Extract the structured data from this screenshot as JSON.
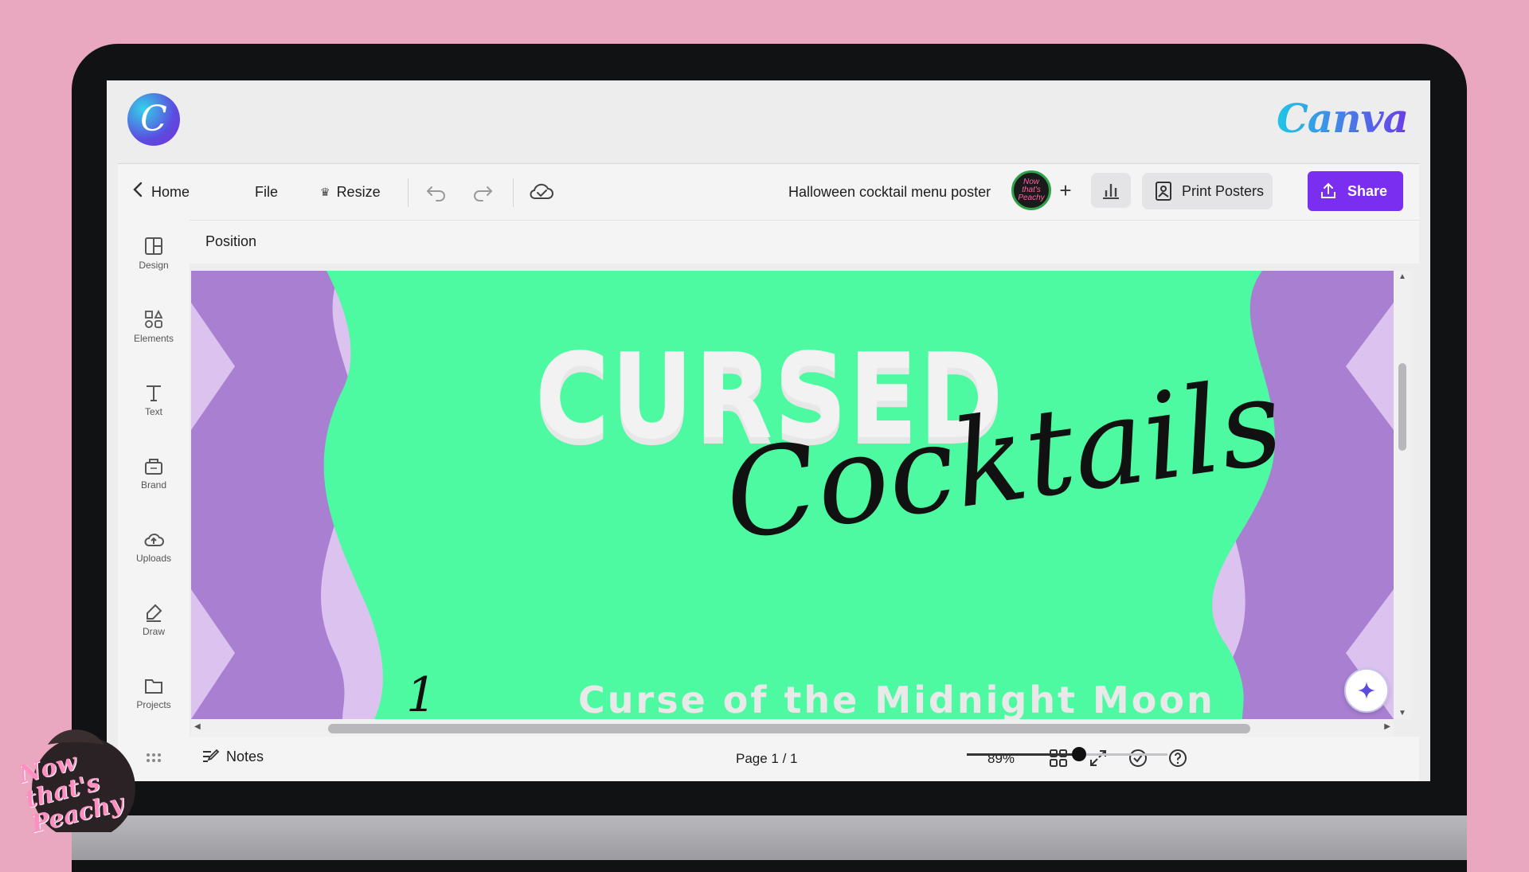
{
  "app": {
    "wordmark": "Canva",
    "logo_letter": "C"
  },
  "toolbar": {
    "home_label": "Home",
    "file_label": "File",
    "resize_label": "Resize",
    "doc_title": "Halloween cocktail menu poster",
    "print_label": "Print Posters",
    "share_label": "Share",
    "avatar_text": "Now that's Peachy"
  },
  "sidebar": {
    "items": [
      {
        "label": "Design",
        "icon": "layout-icon"
      },
      {
        "label": "Elements",
        "icon": "shapes-icon"
      },
      {
        "label": "Text",
        "icon": "text-icon"
      },
      {
        "label": "Brand",
        "icon": "brand-icon"
      },
      {
        "label": "Uploads",
        "icon": "upload-icon"
      },
      {
        "label": "Draw",
        "icon": "pen-icon"
      },
      {
        "label": "Projects",
        "icon": "folder-icon"
      }
    ]
  },
  "context_bar": {
    "label": "Position"
  },
  "canvas": {
    "title_main": "CURSED",
    "title_script": "Cocktails",
    "item_number": "1",
    "item_name": "Curse of the Midnight Moon",
    "colors": {
      "background": "#4dfaa2",
      "waves": "#a87fd1",
      "edge": "#dcc2ee"
    }
  },
  "bottom": {
    "notes_label": "Notes",
    "page_indicator": "Page 1 / 1",
    "zoom": "89%",
    "zoom_value": 0.56
  },
  "watermark": {
    "text": "Now that's Peachy"
  },
  "colors": {
    "accent": "#7a2ff0",
    "background": "#e9a8c0"
  }
}
